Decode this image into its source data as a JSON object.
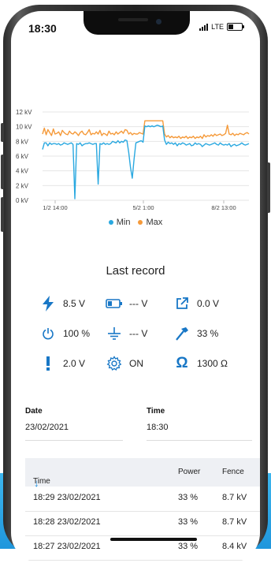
{
  "status_bar": {
    "time": "18:30",
    "network": "LTE"
  },
  "chart_data": {
    "type": "line",
    "x_ticks": [
      "1/2 14:00",
      "5/2 1:00",
      "8/2 13:00"
    ],
    "y_ticks": [
      "12 kV",
      "10 kV",
      "8 kV",
      "6 kV",
      "4 kV",
      "2 kV",
      "0 kV"
    ],
    "ylim": [
      0,
      12
    ],
    "grid": true,
    "legend_placement": "bottom",
    "series": [
      {
        "name": "Min",
        "color": "#29a8e0",
        "values": [
          6.9,
          7.8,
          7.8,
          7.4,
          7.8,
          7.6,
          7.7,
          7.7,
          7.6,
          7.7,
          7.5,
          7.6,
          7.8,
          7.7,
          7.6,
          7.7,
          7.8,
          7.6,
          0.2,
          7.7,
          7.6,
          7.8,
          7.4,
          7.6,
          7.7,
          7.7,
          7.8,
          7.7,
          7.6,
          7.7,
          7.7,
          2.2,
          7.7,
          7.6,
          7.8,
          7.6,
          7.7,
          7.6,
          7.7,
          8.0,
          7.9,
          7.8,
          8.1,
          7.8,
          8.0,
          7.9,
          8.2,
          8.1,
          6.5,
          4.5,
          3.0,
          5.6,
          7.8,
          7.9,
          8.0,
          8.1,
          7.9,
          10.1,
          10.0,
          10.1,
          10.0,
          10.1,
          10.0,
          10.1,
          10.2,
          10.1,
          10.0,
          10.1,
          8.2,
          7.6,
          7.9,
          7.7,
          7.8,
          7.6,
          7.8,
          7.4,
          7.7,
          7.6,
          7.8,
          7.7,
          7.5,
          7.6,
          7.7,
          7.4,
          7.5,
          7.8,
          7.6,
          7.7,
          7.6,
          7.3,
          7.5,
          7.7,
          7.6,
          7.5,
          7.6,
          7.7,
          7.8,
          7.6,
          7.5,
          7.8,
          7.6,
          7.5,
          7.6,
          7.5,
          7.7,
          7.3,
          7.5,
          7.6,
          7.4,
          7.5,
          7.6,
          7.8,
          7.6,
          7.5,
          7.6,
          7.7
        ]
      },
      {
        "name": "Max",
        "color": "#f59a3a",
        "values": [
          9.0,
          9.8,
          8.9,
          9.6,
          9.2,
          8.8,
          9.7,
          9.0,
          9.1,
          9.3,
          8.8,
          9.5,
          9.2,
          9.0,
          8.9,
          9.4,
          9.1,
          9.0,
          9.3,
          9.1,
          8.8,
          9.2,
          9.4,
          9.0,
          8.9,
          9.2,
          9.6,
          8.9,
          9.1,
          9.0,
          9.3,
          9.0,
          9.5,
          8.8,
          9.1,
          9.0,
          8.8,
          9.4,
          9.0,
          9.1,
          8.9,
          9.3,
          9.0,
          9.2,
          9.4,
          9.1,
          9.6,
          9.5,
          9.0,
          9.2,
          8.9,
          9.1,
          9.0,
          9.0,
          9.2,
          9.1,
          9.0,
          10.8,
          10.8,
          10.8,
          10.8,
          10.8,
          10.8,
          10.8,
          10.8,
          10.8,
          10.8,
          10.8,
          9.0,
          8.6,
          8.8,
          8.5,
          8.7,
          8.5,
          8.6,
          8.5,
          8.7,
          8.4,
          8.6,
          8.5,
          8.7,
          8.4,
          8.6,
          8.5,
          8.7,
          8.4,
          8.6,
          8.5,
          8.7,
          8.4,
          8.9,
          8.6,
          8.8,
          8.7,
          8.9,
          8.7,
          9.0,
          8.8,
          8.9,
          9.0,
          8.8,
          8.9,
          9.1,
          10.2,
          9.0,
          8.9,
          9.1,
          8.8,
          9.0,
          8.9,
          9.1,
          9.0,
          8.9,
          9.1,
          9.2,
          9.0
        ]
      }
    ]
  },
  "last_record": {
    "title": "Last record",
    "items": [
      {
        "name": "voltage",
        "value": "8.5 V",
        "icon": "lightning-icon"
      },
      {
        "name": "battery",
        "value": "--- V",
        "icon": "battery-icon"
      },
      {
        "name": "output",
        "value": "0.0 V",
        "icon": "external-arrow-icon"
      },
      {
        "name": "power",
        "value": "100 %",
        "icon": "power-icon"
      },
      {
        "name": "ground",
        "value": "--- V",
        "icon": "ground-icon"
      },
      {
        "name": "fence-percent",
        "value": "33 %",
        "icon": "hammer-icon"
      },
      {
        "name": "alarm",
        "value": "2.0 V",
        "icon": "exclamation-icon"
      },
      {
        "name": "settings",
        "value": "ON",
        "icon": "gear-icon"
      },
      {
        "name": "resistance",
        "value": "1300 Ω",
        "icon": "omega-icon"
      }
    ]
  },
  "date_field": {
    "label": "Date",
    "value": "23/02/2021"
  },
  "time_field": {
    "label": "Time",
    "value": "18:30"
  },
  "table": {
    "headers": {
      "time": "Time",
      "power": "Power",
      "fence": "Fence"
    },
    "rows": [
      {
        "time": "18:29 23/02/2021",
        "power": "33 %",
        "fence": "8.7 kV"
      },
      {
        "time": "18:28 23/02/2021",
        "power": "33 %",
        "fence": "8.7 kV"
      },
      {
        "time": "18:27 23/02/2021",
        "power": "33 %",
        "fence": "8.4 kV"
      }
    ]
  },
  "colors": {
    "accent": "#1a8fe0",
    "min": "#29a8e0",
    "max": "#f59a3a",
    "icon": "#1877c6"
  }
}
